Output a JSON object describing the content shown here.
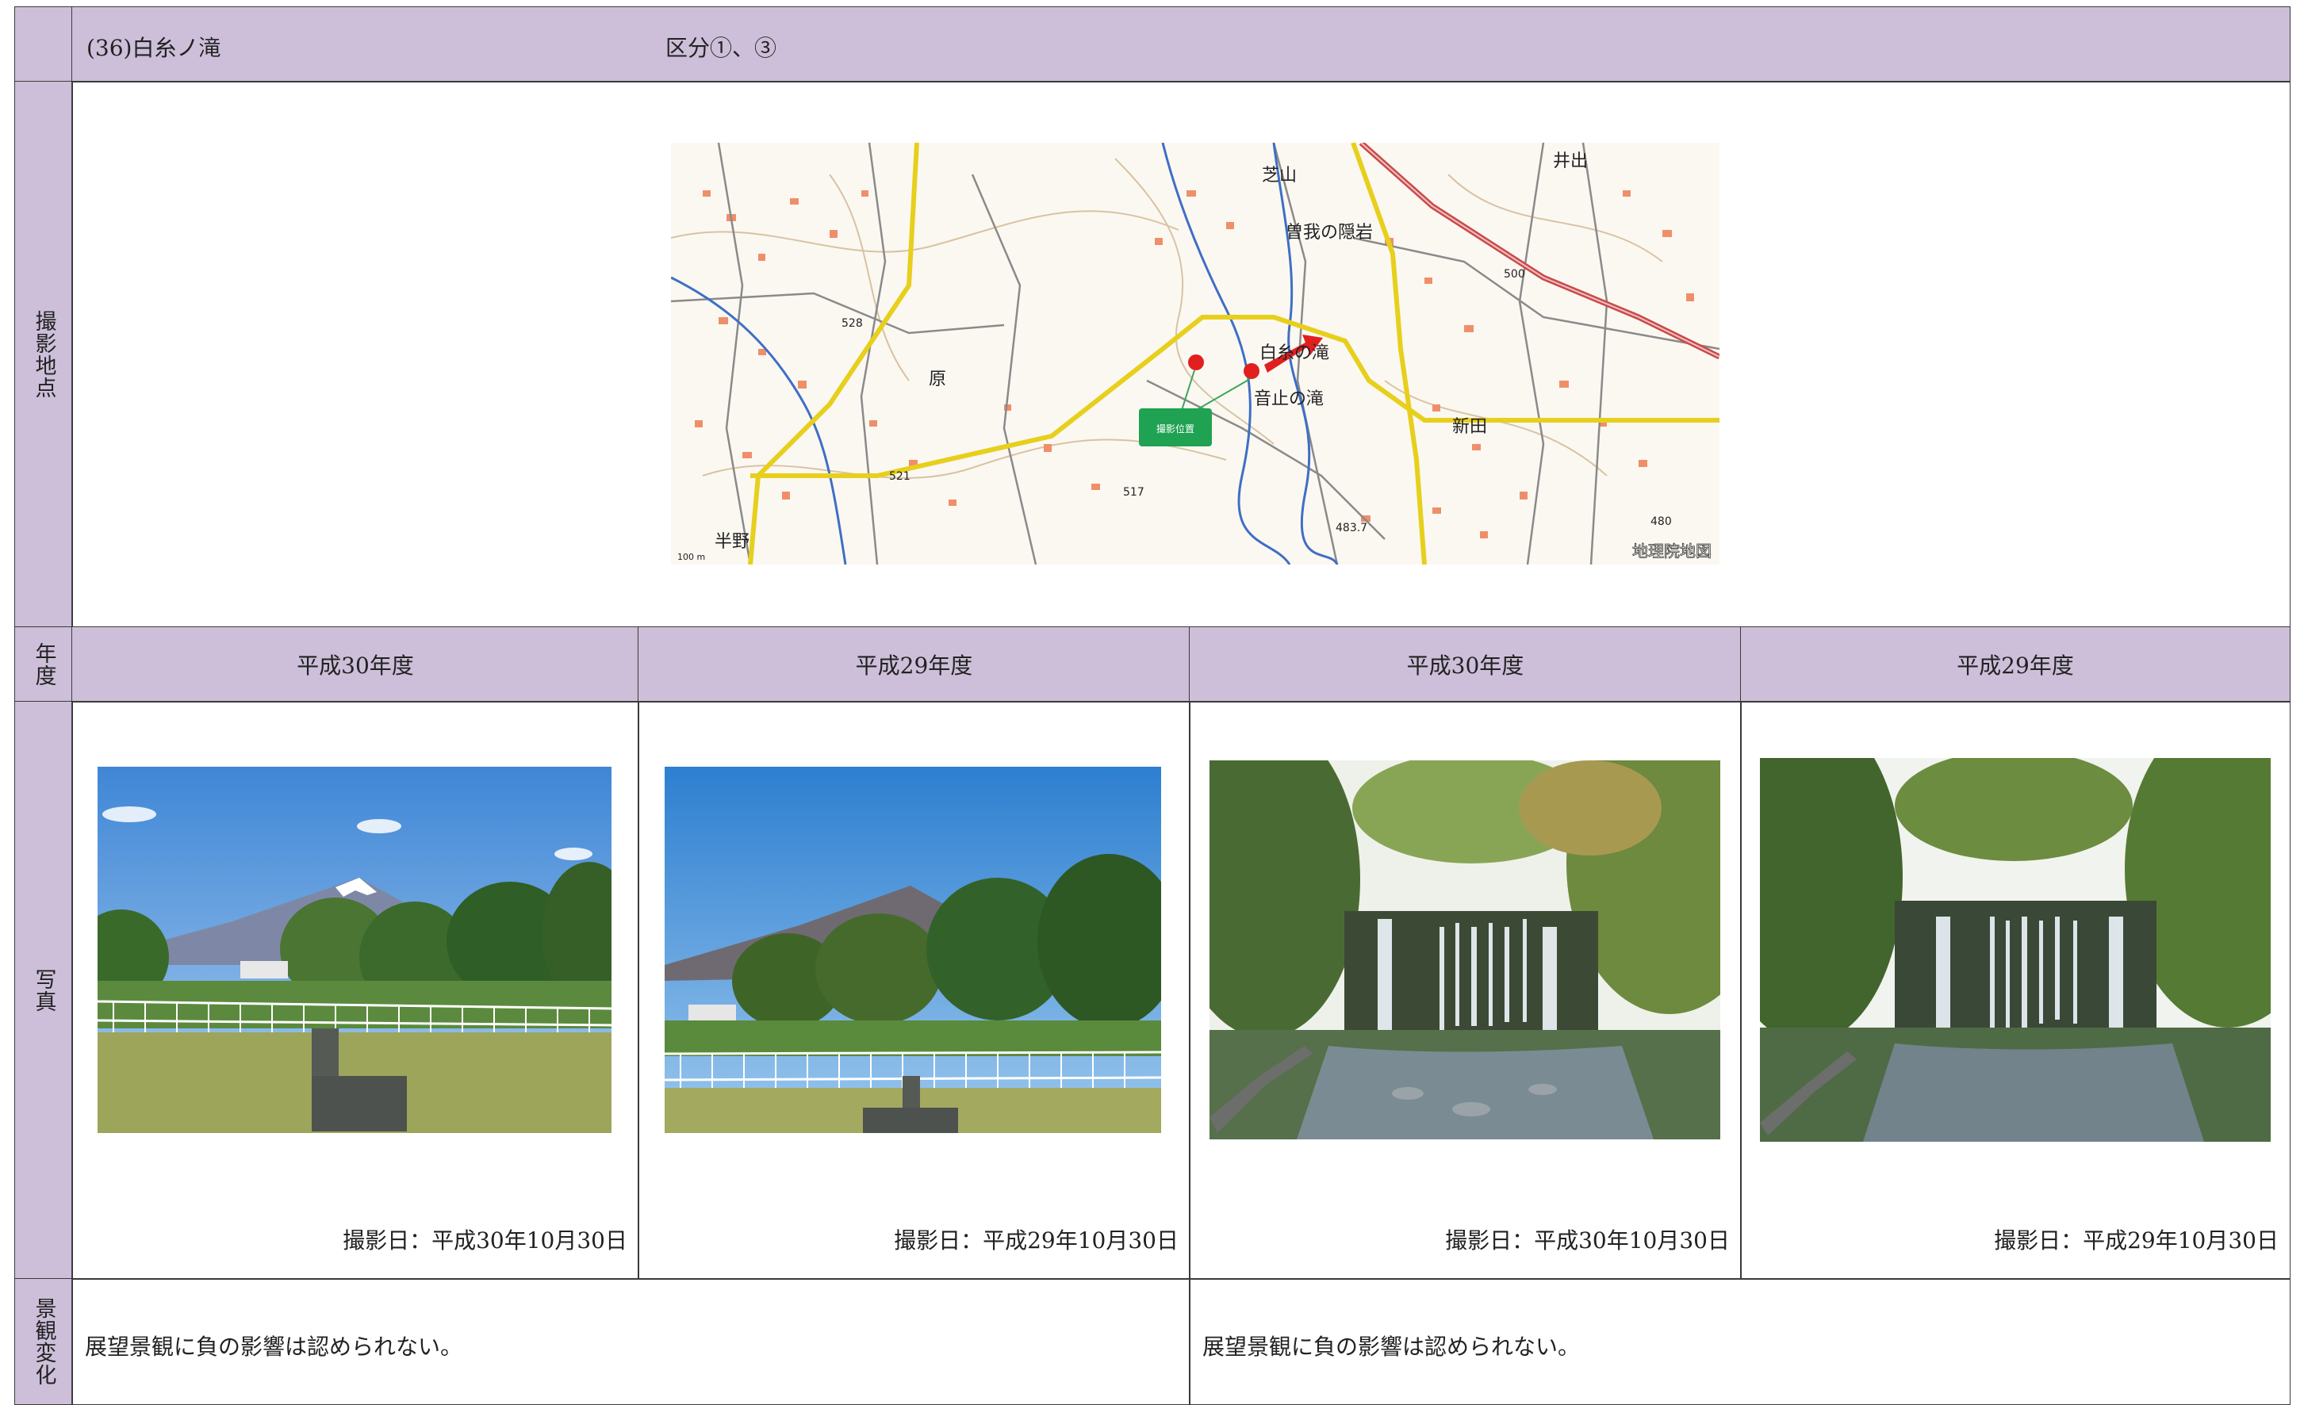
{
  "header": {
    "site_name": "(36)白糸ノ滝",
    "category": "区分①、③"
  },
  "row_labels": {
    "location": "撮影地点",
    "year": "年度",
    "photo": "写真",
    "change": "景観変化"
  },
  "map": {
    "labels": [
      "芝山",
      "井出",
      "曽我の隠岩",
      "白糸の滝",
      "音止の滝",
      "新田",
      "原",
      "半野",
      "528",
      "521",
      "517",
      "480",
      "483.7",
      "500",
      "100 m"
    ],
    "marker_label": "撮影位置",
    "credit": "地理院地図"
  },
  "columns": [
    {
      "year": "平成30年度",
      "date": "撮影日：平成30年10月30日"
    },
    {
      "year": "平成29年度",
      "date": "撮影日：平成29年10月30日"
    },
    {
      "year": "平成30年度",
      "date": "撮影日：平成30年10月30日"
    },
    {
      "year": "平成29年度",
      "date": "撮影日：平成29年10月30日"
    }
  ],
  "assessment": {
    "left": "展望景観に負の影響は認められない。",
    "right": "展望景観に負の影響は認められない。"
  },
  "colors": {
    "header_bg": "#cdbfd9",
    "border": "#3a3a3a"
  }
}
